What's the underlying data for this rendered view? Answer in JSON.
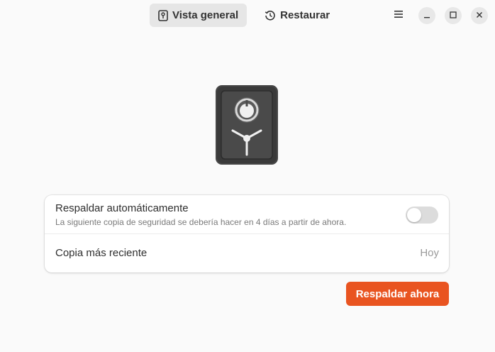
{
  "header": {
    "tabs": [
      {
        "label": "Vista general",
        "icon": "safe-icon",
        "active": true
      },
      {
        "label": "Restaurar",
        "icon": "history-icon",
        "active": false
      }
    ],
    "menu_icon": "hamburger-menu-icon",
    "window_controls": [
      "minimize-icon",
      "maximize-icon",
      "close-icon"
    ]
  },
  "main": {
    "illustration_icon": "safe-icon",
    "auto_backup": {
      "title": "Respaldar automáticamente",
      "subtitle": "La siguiente copia de seguridad se debería hacer en 4 días a partir de ahora.",
      "enabled": false
    },
    "last_backup": {
      "label": "Copia más reciente",
      "value": "Hoy"
    },
    "backup_button": "Respaldar ahora"
  },
  "colors": {
    "accent": "#e95420",
    "background": "#fafafa",
    "card": "#ffffff"
  }
}
